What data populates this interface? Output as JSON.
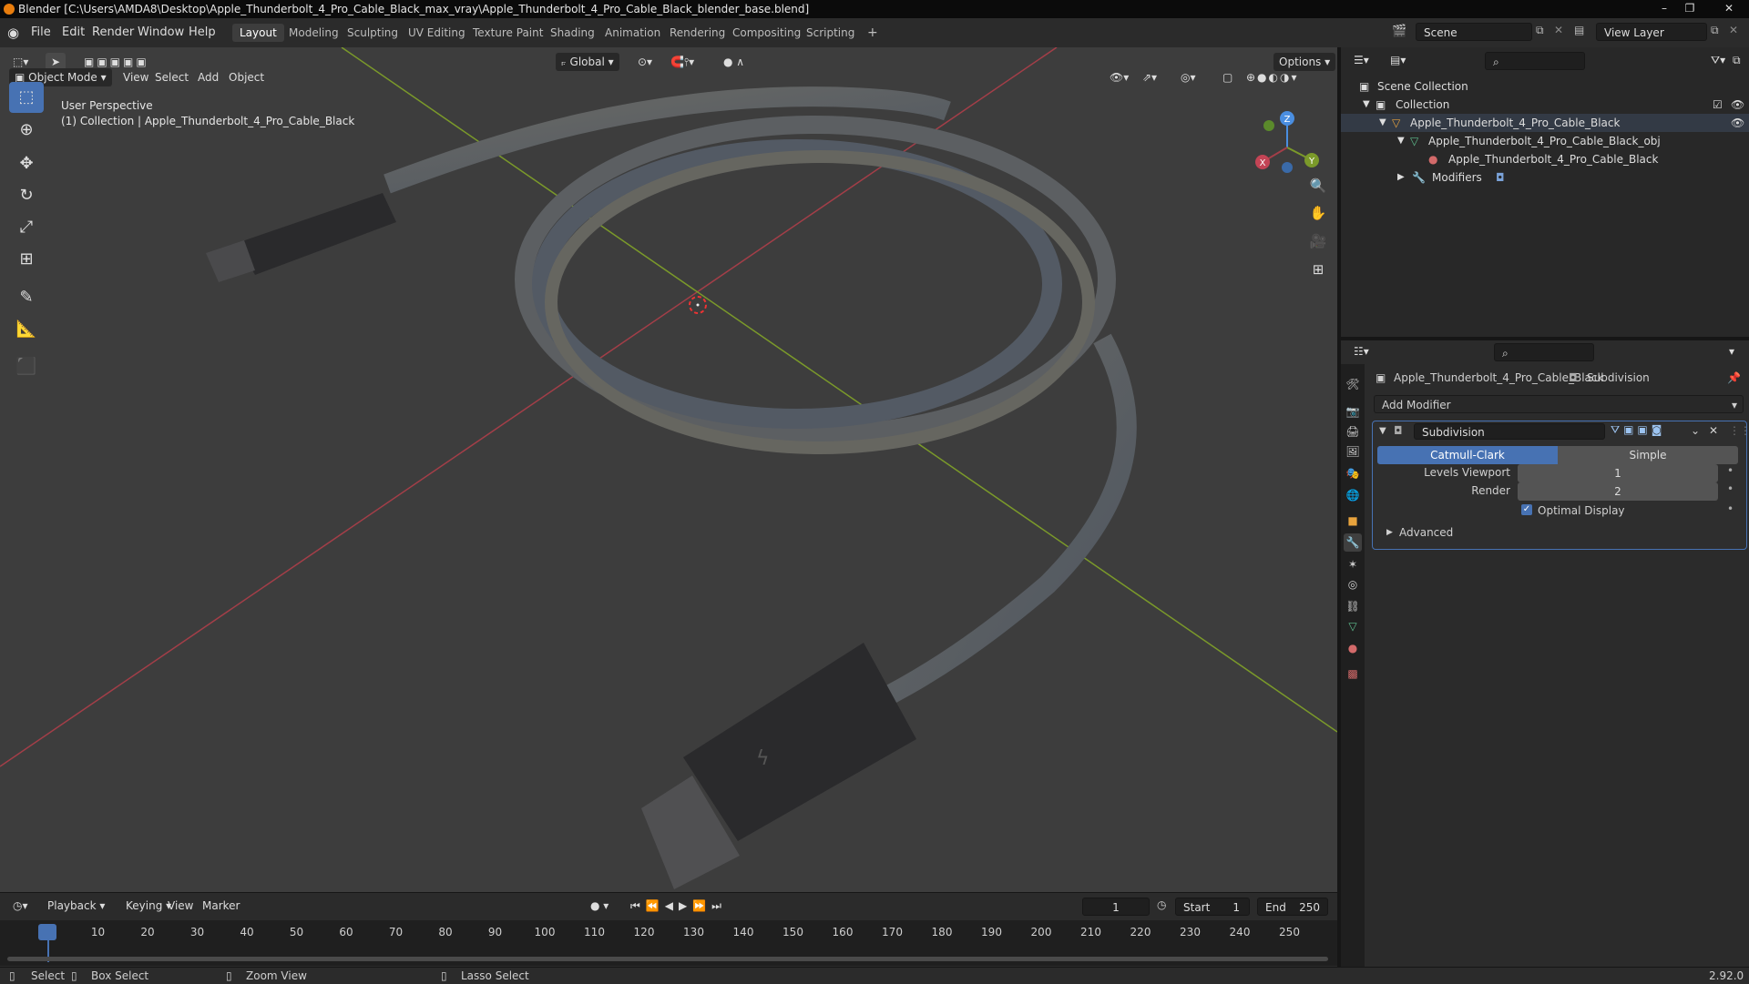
{
  "window": {
    "title": "Blender [C:\\Users\\AMDA8\\Desktop\\Apple_Thunderbolt_4_Pro_Cable_Black_max_vray\\Apple_Thunderbolt_4_Pro_Cable_Black_blender_base.blend]",
    "minimize": "–",
    "maximize": "❐",
    "close": "✕"
  },
  "menus": [
    "File",
    "Edit",
    "Render",
    "Window",
    "Help"
  ],
  "workspaces": [
    "Layout",
    "Modeling",
    "Sculpting",
    "UV Editing",
    "Texture Paint",
    "Shading",
    "Animation",
    "Rendering",
    "Compositing",
    "Scripting",
    "+"
  ],
  "scene": {
    "name": "Scene",
    "view_layer": "View Layer"
  },
  "viewport": {
    "mode": "Object Mode",
    "menu": [
      "View",
      "Select",
      "Add",
      "Object"
    ],
    "transform_orientation": "Global",
    "options": "Options",
    "overlay_line1": "User Perspective",
    "overlay_line2": "(1) Collection | Apple_Thunderbolt_4_Pro_Cable_Black",
    "gizmo": {
      "x": "X",
      "y": "Y",
      "z": "Z"
    }
  },
  "timeline": {
    "menu": [
      "Playback",
      "Keying",
      "View",
      "Marker"
    ],
    "current_frame": "1",
    "start_label": "Start",
    "start_value": "1",
    "end_label": "End",
    "end_value": "250",
    "ticks": [
      "1",
      "10",
      "20",
      "30",
      "40",
      "50",
      "60",
      "70",
      "80",
      "90",
      "100",
      "110",
      "120",
      "130",
      "140",
      "150",
      "160",
      "170",
      "180",
      "190",
      "200",
      "210",
      "220",
      "230",
      "240",
      "250"
    ]
  },
  "status": {
    "select": "Select",
    "box_select": "Box Select",
    "zoom_view": "Zoom View",
    "lasso_select": "Lasso Select",
    "version": "2.92.0"
  },
  "outliner": {
    "root": "Scene Collection",
    "collection": "Collection",
    "object": "Apple_Thunderbolt_4_Pro_Cable_Black",
    "mesh": "Apple_Thunderbolt_4_Pro_Cable_Black_obj",
    "material": "Apple_Thunderbolt_4_Pro_Cable_Black",
    "modifiers": "Modifiers"
  },
  "properties": {
    "object_name": "Apple_Thunderbolt_4_Pro_Cable_Black",
    "modifier_context": "Subdivision",
    "add_modifier": "Add Modifier",
    "modifier_name": "Subdivision",
    "mode_catmull": "Catmull-Clark",
    "mode_simple": "Simple",
    "levels_viewport_label": "Levels Viewport",
    "levels_viewport_value": "1",
    "render_label": "Render",
    "render_value": "2",
    "optimal_display": "Optimal Display",
    "advanced": "Advanced"
  },
  "colors": {
    "accent": "#4772b3",
    "x_axis": "#a33e48",
    "y_axis": "#7b9a2a",
    "z_axis": "#4a8ee0",
    "viewport_bg": "#3d3d3d",
    "panel_bg": "#2b2b2b"
  }
}
